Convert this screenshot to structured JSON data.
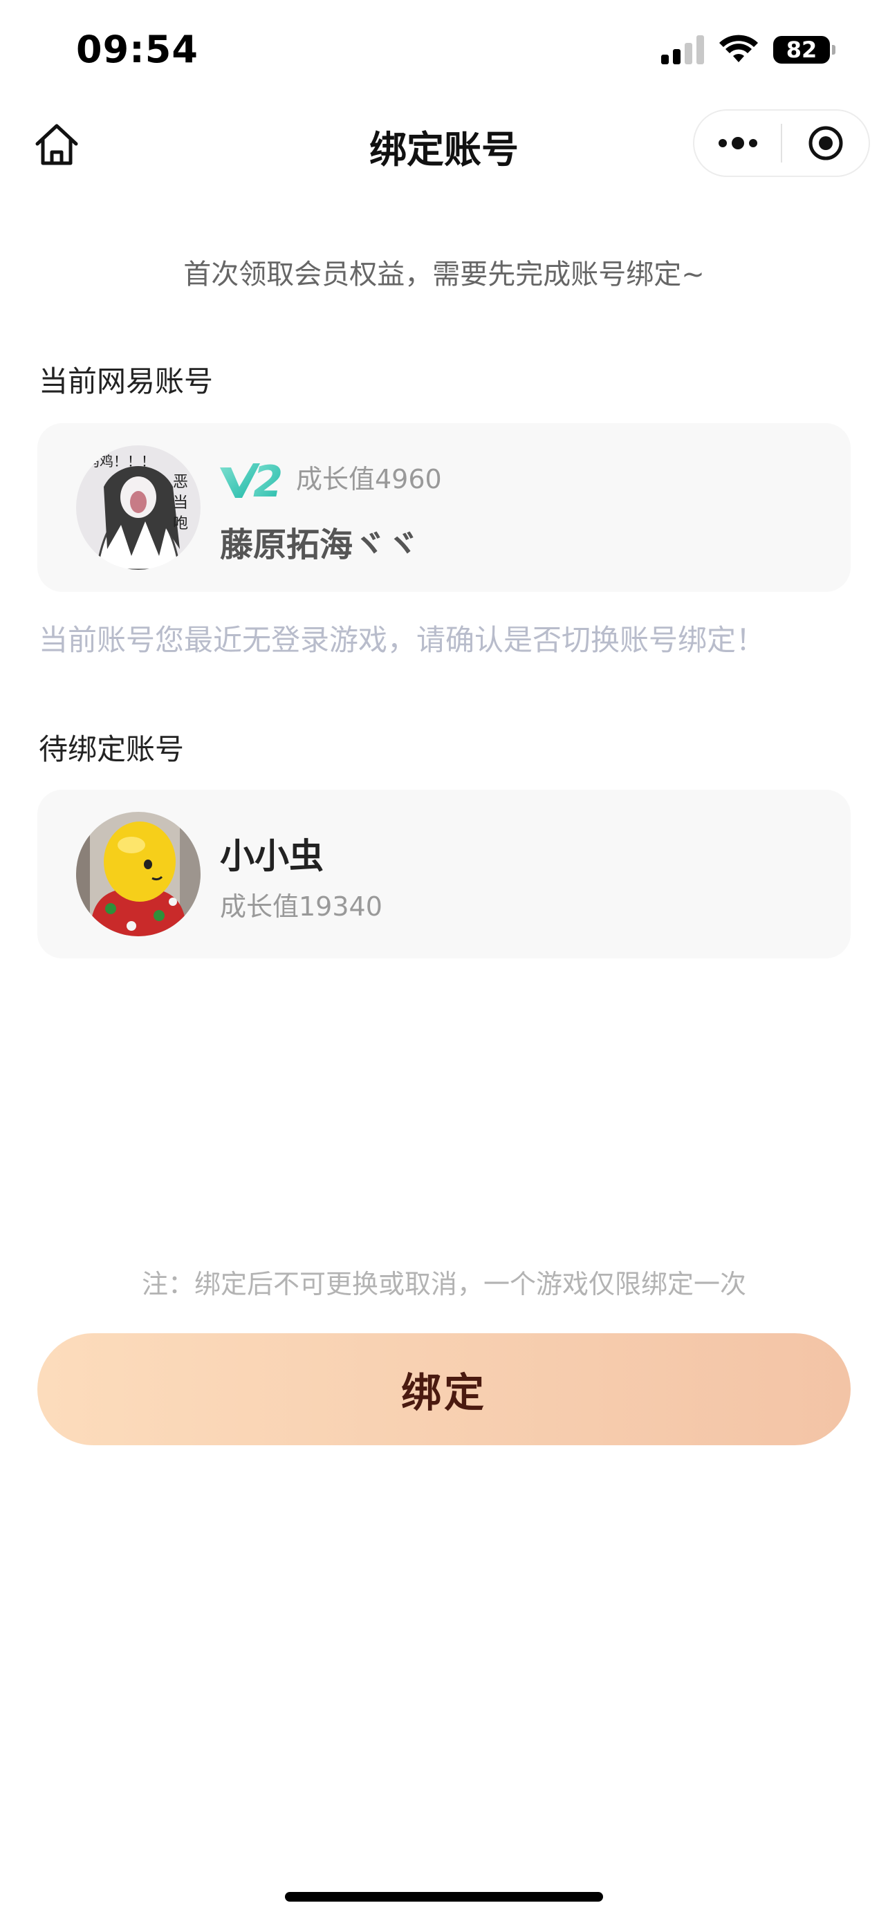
{
  "status_bar": {
    "time": "09:54",
    "battery": "82"
  },
  "navbar": {
    "title": "绑定账号"
  },
  "intro": "首次领取会员权益，需要先完成账号绑定~",
  "current": {
    "label": "当前网易账号",
    "vip_level": "V2",
    "growth": "成长值4960",
    "name": "藤原拓海ヾヾ",
    "warning": "当前账号您最近无登录游戏，请确认是否切换账号绑定！"
  },
  "pending": {
    "label": "待绑定账号",
    "name": "小小虫",
    "growth": "成长值19340"
  },
  "note": "注：绑定后不可更换或取消，一个游戏仅限绑定一次",
  "bind_button": "绑定",
  "icons": {
    "home": "home-icon",
    "more": "more-dots-icon",
    "close": "target-circle-icon"
  },
  "colors": {
    "vip_teal": "#2ec4b6",
    "button_start": "#fcdcbc",
    "button_end": "#f3c4a6",
    "button_text": "#4a1a10"
  }
}
